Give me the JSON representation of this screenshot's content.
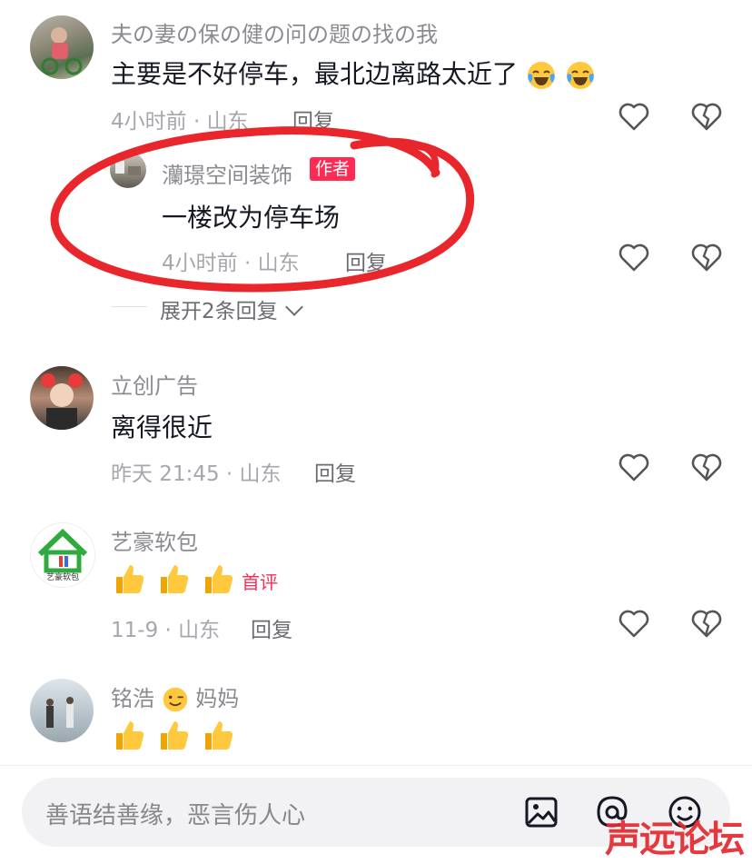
{
  "comments": [
    {
      "user": "夫の妻の保の健の问の题の找の我",
      "text": "主要是不好停车，最北边离路太近了",
      "meta": "4小时前 · 山东",
      "reply": "回复"
    },
    {
      "user": "立创广告",
      "text": "离得很近",
      "meta": "昨天 21:45 · 山东",
      "reply": "回复"
    },
    {
      "user": "艺豪软包",
      "tag": "首评",
      "meta": "11-9 · 山东",
      "reply": "回复"
    },
    {
      "user_part1": "铭浩",
      "user_part2": "妈妈"
    }
  ],
  "sub_reply": {
    "user": "灡璟空间装饰",
    "author_tag": "作者",
    "text": "一楼改为停车场",
    "meta": "4小时前 · 山东",
    "reply": "回复"
  },
  "expand": {
    "label": "展开2条回复"
  },
  "avatar3_text": "艺豪软包",
  "bottom": {
    "placeholder": "善语结善缘，恶言伤人心"
  },
  "watermark": "声远论坛",
  "colors": {
    "accent": "#fe2c55",
    "circle": "#e8262b"
  }
}
